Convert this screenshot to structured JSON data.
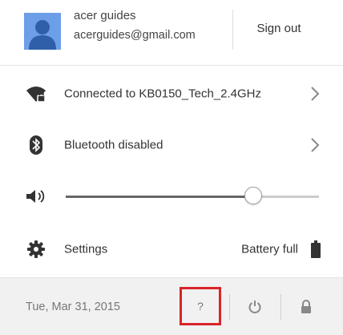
{
  "account": {
    "name": "acer guides",
    "email": "acerguides@gmail.com",
    "sign_out_label": "Sign out",
    "avatar_color": "#6d9ee8"
  },
  "network": {
    "label": "Connected to KB0150_Tech_2.4GHz",
    "icon": "wifi-locked-icon"
  },
  "bluetooth": {
    "label": "Bluetooth disabled",
    "icon": "bluetooth-icon"
  },
  "volume": {
    "icon": "speaker-icon",
    "level_percent": 74
  },
  "settings": {
    "label": "Settings",
    "icon": "gear-icon",
    "battery_label": "Battery full",
    "battery_icon": "battery-full-icon"
  },
  "footer": {
    "date": "Tue, Mar 31, 2015",
    "help_label": "?",
    "help_highlight_color": "#d9242a",
    "power_icon": "power-icon",
    "lock_icon": "lock-icon"
  }
}
